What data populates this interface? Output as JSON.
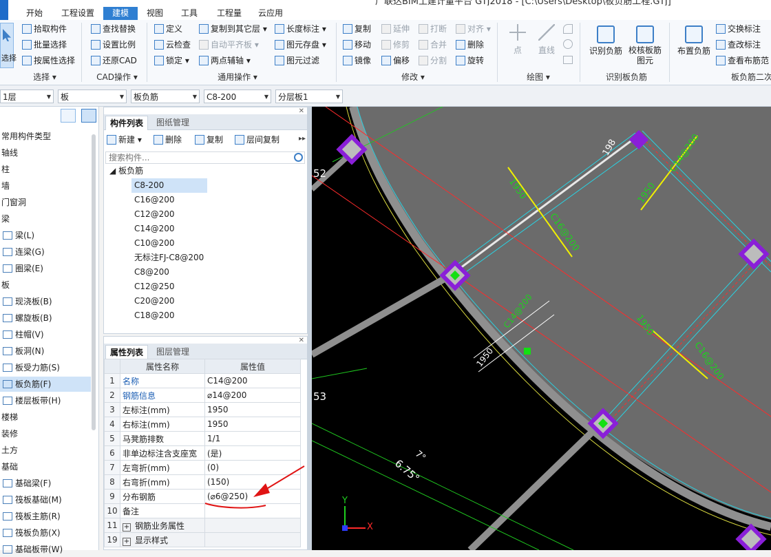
{
  "window": {
    "title": "广联达BIM土建计量平台 GTJ2018 - [C:\\Users\\Desktop\\板负筋工程.GTJ]"
  },
  "menu_tabs": [
    "开始",
    "工程设置",
    "建模",
    "视图",
    "工具",
    "工程量",
    "云应用"
  ],
  "active_tab": "建模",
  "ribbon": {
    "select_group": {
      "big": "选择",
      "items": [
        "拾取构件",
        "批量选择",
        "按属性选择"
      ],
      "label": "选择"
    },
    "cad_group": {
      "items": [
        "查找替换",
        "设置比例",
        "还原CAD"
      ],
      "label": "CAD操作"
    },
    "common_group": {
      "items": [
        "定义",
        "云检查",
        "锁定",
        "复制到其它层",
        "自动平齐板",
        "两点辅轴",
        "长度标注",
        "图元存盘",
        "图元过滤"
      ],
      "label": "通用操作"
    },
    "modify_group": {
      "items": [
        "复制",
        "移动",
        "镜像",
        "延伸",
        "修剪",
        "偏移",
        "打断",
        "合并",
        "分割",
        "对齐",
        "删除",
        "旋转"
      ],
      "label": "修改"
    },
    "draw_group": {
      "items": [
        "点",
        "直线"
      ],
      "label": "绘图"
    },
    "identify_group": {
      "items": [
        "识别负筋",
        "校核板筋图元"
      ],
      "label": "识别板负筋"
    },
    "neg_group": {
      "items": [
        "布置负筋",
        "交换标注",
        "查改标注",
        "查看布筋范"
      ],
      "label": "板负筋二次"
    }
  },
  "filters": {
    "floor": "1层",
    "type": "板",
    "sub": "板负筋",
    "comp": "C8-200",
    "layer": "分层板1"
  },
  "left_nav": {
    "items": [
      "常用构件类型",
      "轴线",
      "柱",
      "墙",
      "门窗洞",
      "梁",
      "梁(L)",
      "连梁(G)",
      "圈梁(E)",
      "板",
      "现浇板(B)",
      "螺旋板(B)",
      "柱帽(V)",
      "板洞(N)",
      "板受力筋(S)",
      "板负筋(F)",
      "楼层板带(H)",
      "楼梯",
      "装修",
      "土方",
      "基础",
      "基础梁(F)",
      "筏板基础(M)",
      "筏板主筋(R)",
      "筏板负筋(X)",
      "基础板带(W)"
    ],
    "selected": "板负筋(F)"
  },
  "comp_panel": {
    "tabs": [
      "构件列表",
      "图纸管理"
    ],
    "toolbar": [
      "新建",
      "删除",
      "复制",
      "层间复制"
    ],
    "search_placeholder": "搜索构件...",
    "root": "板负筋",
    "items": [
      "C8-200",
      "C16@200",
      "C12@200",
      "C14@200",
      "C10@200",
      "无标注FJ-C8@200",
      "C8@200",
      "C12@250",
      "C20@200",
      "C18@200"
    ],
    "selected": "C8-200"
  },
  "prop_panel": {
    "tabs": [
      "属性列表",
      "图层管理"
    ],
    "headers": [
      "属性名称",
      "属性值"
    ],
    "rows": [
      {
        "n": "1",
        "k": "名称",
        "v": "C14@200",
        "blue": true
      },
      {
        "n": "2",
        "k": "钢筋信息",
        "v": "⌀14@200",
        "blue": true
      },
      {
        "n": "3",
        "k": "左标注(mm)",
        "v": "1950",
        "blue": false
      },
      {
        "n": "4",
        "k": "右标注(mm)",
        "v": "1950",
        "blue": false
      },
      {
        "n": "5",
        "k": "马凳筋排数",
        "v": "1/1",
        "blue": false
      },
      {
        "n": "6",
        "k": "非单边标注含支座宽",
        "v": "(是)",
        "blue": false
      },
      {
        "n": "7",
        "k": "左弯折(mm)",
        "v": "(0)",
        "blue": false
      },
      {
        "n": "8",
        "k": "右弯折(mm)",
        "v": "(150)",
        "blue": false
      },
      {
        "n": "9",
        "k": "分布钢筋",
        "v": "(⌀6@250)",
        "blue": false
      },
      {
        "n": "10",
        "k": "备注",
        "v": "",
        "blue": false
      },
      {
        "n": "11",
        "k": "钢筋业务属性",
        "v": "",
        "blue": false
      },
      {
        "n": "19",
        "k": "显示样式",
        "v": "",
        "blue": false
      }
    ]
  },
  "canvas": {
    "labels": {
      "n52": "52",
      "n53": "53",
      "deg": "7°",
      "angle": "6.75°",
      "d198": "198",
      "d1950a": "1950",
      "d1950b": "1950",
      "d1950c": "1950",
      "d1950d": "1950",
      "c14a": "C14@200",
      "c16a": "C16@200",
      "c16b": "C16@200",
      "c14b": "C14@200"
    },
    "axis_x": "X",
    "axis_y": "Y"
  },
  "colors": {
    "accent": "#2f7fd2",
    "slab": "#6a6a6a",
    "wall": "#8f8f8f",
    "column": "#8a1fd8",
    "rebar_yellow": "#f0f000",
    "annot_green": "#2fd02f",
    "cyan": "#29d3e3",
    "red": "#ff2b2b"
  }
}
